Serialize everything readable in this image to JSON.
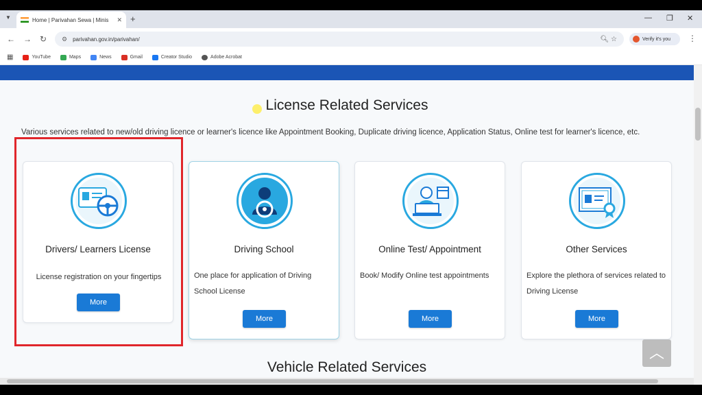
{
  "browser": {
    "tab_title": "Home | Parivahan Sewa | Minis",
    "url": "parivahan.gov.in/parivahan/",
    "verify_label": "Verify it's you",
    "bookmarks": [
      {
        "label": "YouTube",
        "color": "#e62117"
      },
      {
        "label": "Maps",
        "color": "#34a853"
      },
      {
        "label": "News",
        "color": "#4285f4"
      },
      {
        "label": "Gmail",
        "color": "#d93025"
      },
      {
        "label": "Creator Studio",
        "color": "#1877f2"
      },
      {
        "label": "Adobe Acrobat",
        "color": "#555555"
      }
    ]
  },
  "page": {
    "section_title": "License Related Services",
    "description": "Various services related to new/old driving licence or learner's licence like Appointment Booking, Duplicate driving licence, Application Status, Online test for learner's licence, etc.",
    "next_section_title": "Vehicle Related Services",
    "cards": [
      {
        "name": "Drivers/ Learners License",
        "desc": "License registration on your fingertips",
        "button": "More",
        "icon": "license-card-steering-icon"
      },
      {
        "name": "Driving School",
        "desc": "One place for application of Driving School License",
        "button": "More",
        "icon": "driver-steering-icon"
      },
      {
        "name": "Online Test/ Appointment",
        "desc": "Book/ Modify Online test appointments",
        "button": "More",
        "icon": "laptop-calendar-icon"
      },
      {
        "name": "Other Services",
        "desc": "Explore the plethora of services related to Driving License",
        "button": "More",
        "icon": "certificate-icon"
      }
    ]
  },
  "colors": {
    "accent": "#1a7ad6",
    "band": "#1b55b5",
    "icon_ring": "#29a8e0",
    "highlight": "#e0262b"
  }
}
